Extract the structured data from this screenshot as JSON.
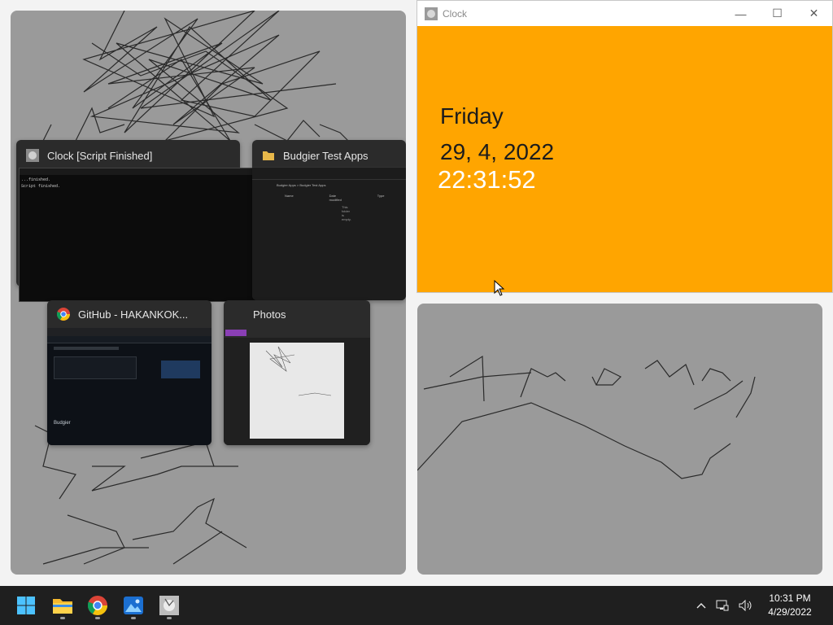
{
  "snap_assist": {
    "cards": [
      {
        "title": "Clock [Script Finished]",
        "thumb_lines": [
          "...finished.",
          "Script finished."
        ]
      },
      {
        "title": "Budgier Test Apps",
        "thumb_path": "Budgier Apps > Budgier Test Apps",
        "thumb_cols": [
          "Name",
          "Date modified",
          "Type"
        ],
        "thumb_empty": "This folder is empty."
      },
      {
        "title": "GitHub - HAKANKOK...",
        "thumb_heading": "Budgier"
      },
      {
        "title": "Photos"
      }
    ]
  },
  "clock_window": {
    "title": "Clock",
    "day": "Friday",
    "date": "29, 4, 2022",
    "time": "22:31:52",
    "background": "#ffa500",
    "controls": {
      "minimize": "—",
      "maximize": "☐",
      "close": "✕"
    }
  },
  "taskbar": {
    "apps": [
      {
        "name": "Start",
        "icon": "windows-logo-icon"
      },
      {
        "name": "File Explorer",
        "icon": "folder-icon"
      },
      {
        "name": "Google Chrome",
        "icon": "chrome-icon"
      },
      {
        "name": "Photos",
        "icon": "photos-icon"
      },
      {
        "name": "Clock",
        "icon": "clock-app-icon"
      }
    ],
    "tray": {
      "time": "10:31 PM",
      "date": "4/29/2022"
    }
  }
}
